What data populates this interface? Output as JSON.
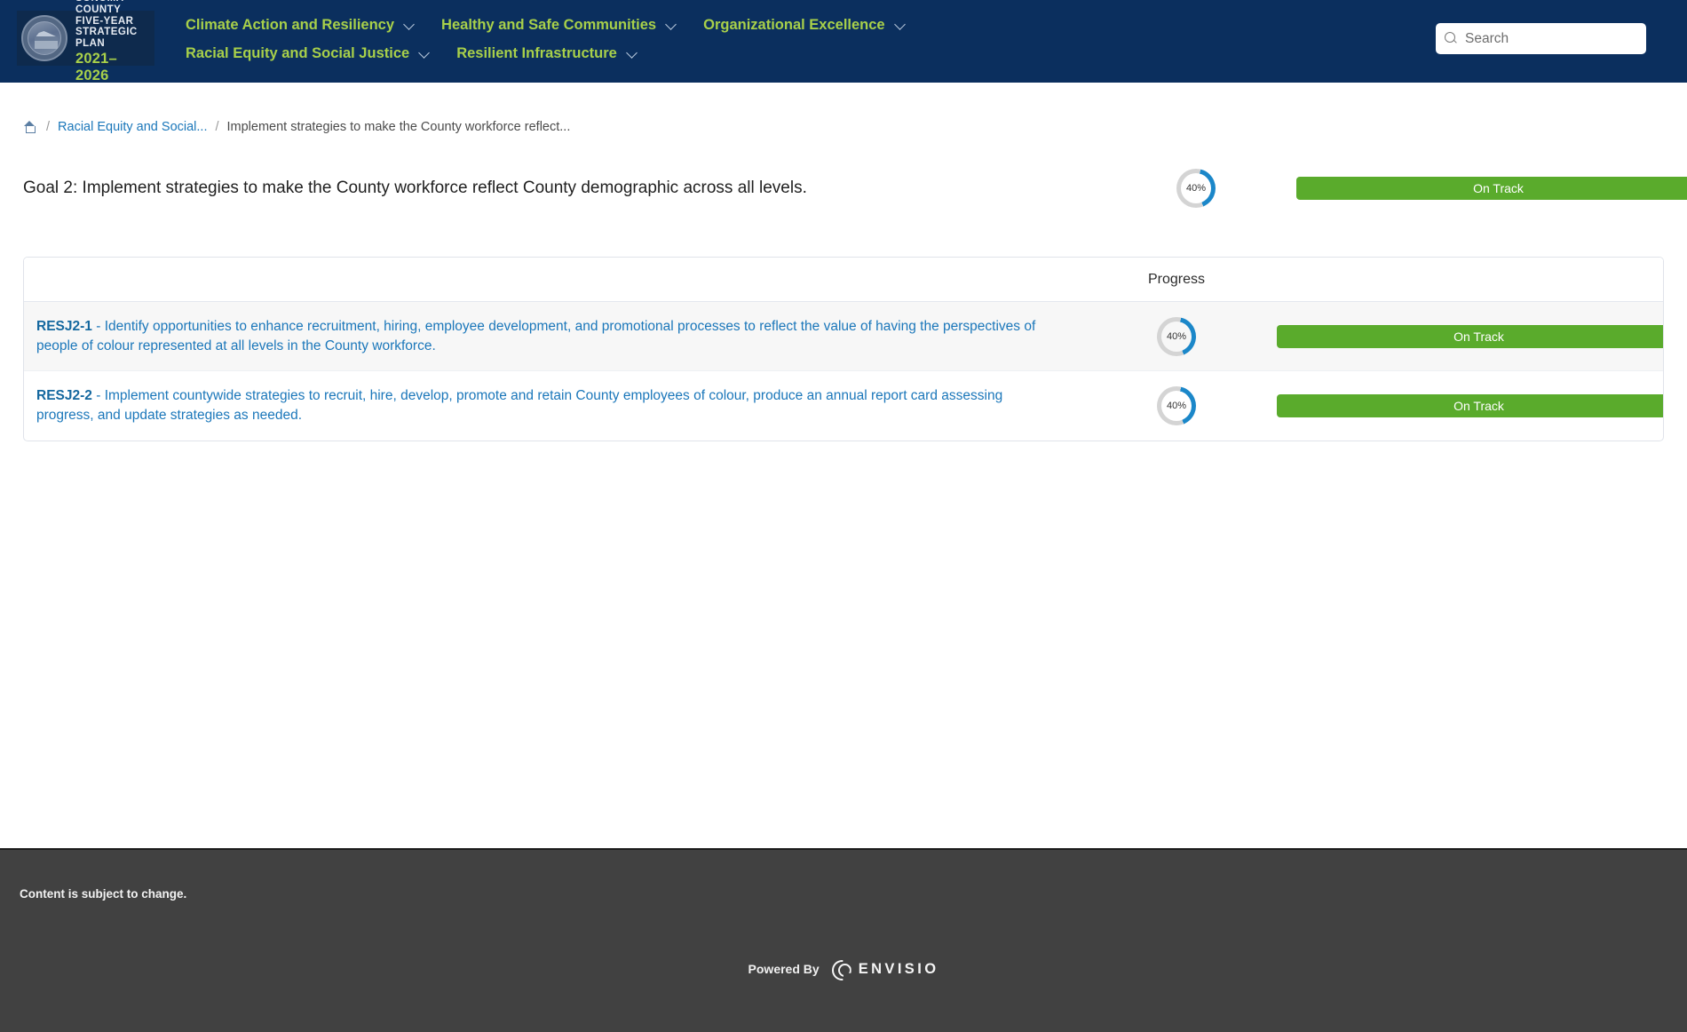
{
  "header": {
    "logo": {
      "line1": "SONOMA COUNTY",
      "line2": "FIVE-YEAR",
      "line3": "STRATEGIC PLAN",
      "line4": "2021–2026",
      "seal_alt": "sonoma-county-seal"
    },
    "nav": [
      {
        "label": "Climate Action and Resiliency",
        "has_caret": true
      },
      {
        "label": "Healthy and Safe Communities",
        "has_caret": true
      },
      {
        "label": "Organizational Excellence",
        "has_caret": true
      },
      {
        "label": "Racial Equity and Social Justice",
        "has_caret": true
      },
      {
        "label": "Resilient Infrastructure",
        "has_caret": true
      }
    ],
    "search": {
      "placeholder": "Search",
      "value": "",
      "icon": "search-icon"
    },
    "colors": {
      "background": "#0b2f5e",
      "nav_link": "#a8d04a",
      "logo_year": "#a8d04a"
    }
  },
  "breadcrumb": {
    "home_icon": "home-icon",
    "separator": "/",
    "items": [
      {
        "label": "Racial Equity and Social...",
        "is_link": true
      },
      {
        "label": "Implement strategies to make the County workforce reflect...",
        "is_link": false
      }
    ]
  },
  "goal": {
    "title": "Goal 2: Implement strategies to make the County workforce reflect County demographic across all levels.",
    "progress_label": "40%",
    "progress_value": 40,
    "status_label": "On Track",
    "status_color": "#5aab2c",
    "progress_color": "#1b87c9",
    "progress_track_color": "#d4d4d4"
  },
  "table": {
    "headers": {
      "name": "",
      "progress": "Progress",
      "status": ""
    },
    "rows": [
      {
        "code": "RESJ2-1",
        "separator": " - ",
        "description": "Identify opportunities to enhance recruitment, hiring, employee development, and promotional processes to reflect the value of having the perspectives of people of colour represented at all levels in the County workforce.",
        "progress_label": "40%",
        "progress_value": 40,
        "status_label": "On Track"
      },
      {
        "code": "RESJ2-2",
        "separator": " - ",
        "description": "Implement countywide strategies to recruit, hire, develop, promote and retain County employees of colour, produce an annual report card assessing progress, and update strategies as needed.",
        "progress_label": "40%",
        "progress_value": 40,
        "status_label": "On Track"
      }
    ]
  },
  "footer": {
    "note": "Content is subject to change.",
    "powered_by_label": "Powered By",
    "brand": "ENVISIO",
    "background": "#414141"
  }
}
